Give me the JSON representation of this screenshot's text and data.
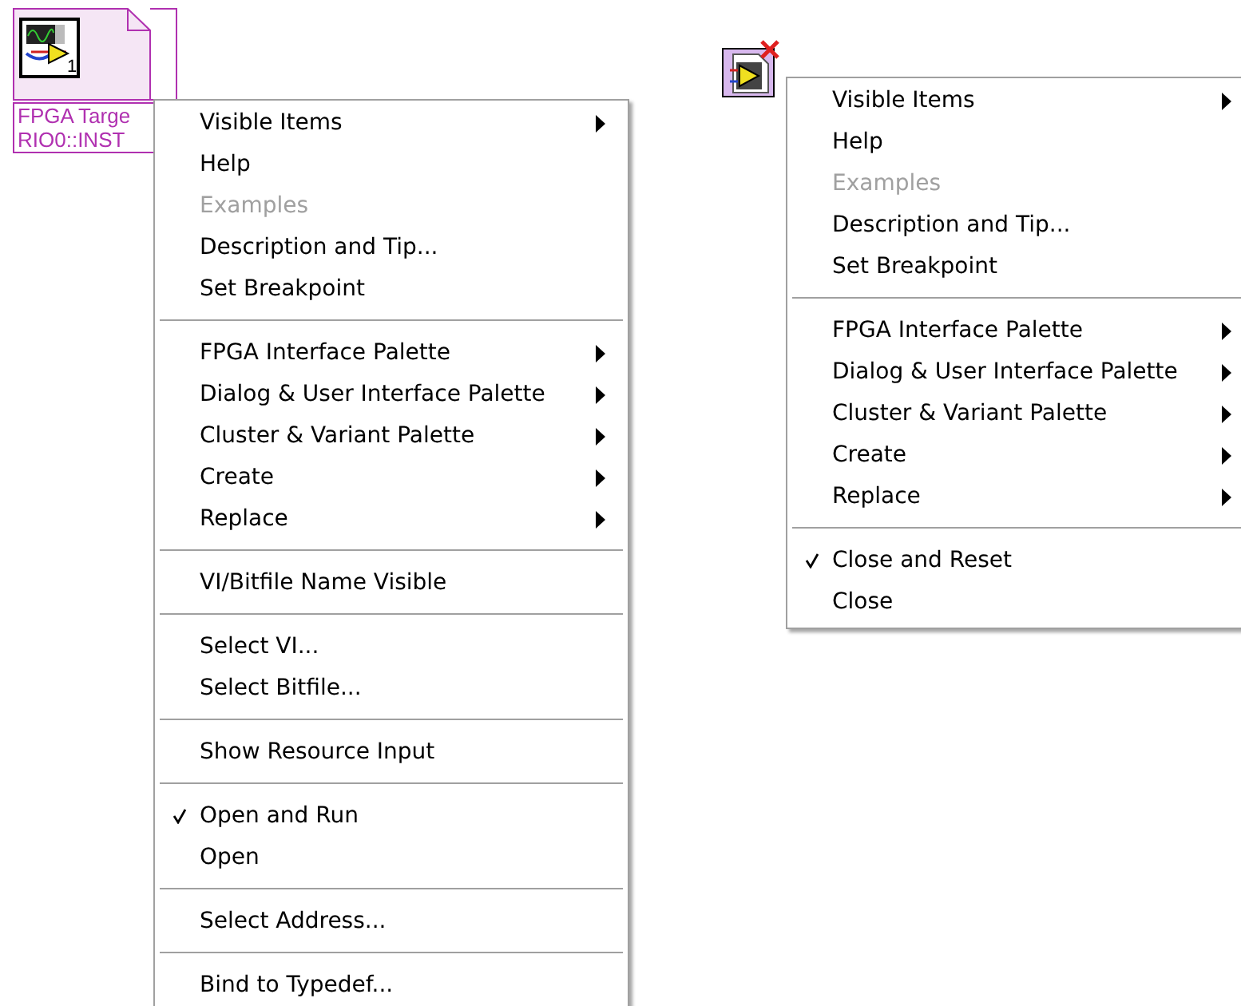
{
  "nodes": [
    {
      "kind": "target",
      "badge": "1",
      "label_lines": [
        "FPGA Targe",
        "RIO0::INST"
      ]
    },
    {
      "kind": "close"
    }
  ],
  "menus": [
    {
      "groups": [
        [
          {
            "label": "Visible Items",
            "submenu": true,
            "disabled": false,
            "checked": false
          },
          {
            "label": "Help",
            "submenu": false,
            "disabled": false,
            "checked": false
          },
          {
            "label": "Examples",
            "submenu": false,
            "disabled": true,
            "checked": false
          },
          {
            "label": "Description and Tip...",
            "submenu": false,
            "disabled": false,
            "checked": false
          },
          {
            "label": "Set Breakpoint",
            "submenu": false,
            "disabled": false,
            "checked": false
          }
        ],
        [
          {
            "label": "FPGA Interface Palette",
            "submenu": true,
            "disabled": false,
            "checked": false
          },
          {
            "label": "Dialog & User Interface Palette",
            "submenu": true,
            "disabled": false,
            "checked": false
          },
          {
            "label": "Cluster & Variant Palette",
            "submenu": true,
            "disabled": false,
            "checked": false
          },
          {
            "label": "Create",
            "submenu": true,
            "disabled": false,
            "checked": false
          },
          {
            "label": "Replace",
            "submenu": true,
            "disabled": false,
            "checked": false
          }
        ],
        [
          {
            "label": "VI/Bitfile Name Visible",
            "submenu": false,
            "disabled": false,
            "checked": false
          }
        ],
        [
          {
            "label": "Select VI...",
            "submenu": false,
            "disabled": false,
            "checked": false
          },
          {
            "label": "Select Bitfile...",
            "submenu": false,
            "disabled": false,
            "checked": false
          }
        ],
        [
          {
            "label": "Show Resource Input",
            "submenu": false,
            "disabled": false,
            "checked": false
          }
        ],
        [
          {
            "label": "Open and Run",
            "submenu": false,
            "disabled": false,
            "checked": true
          },
          {
            "label": "Open",
            "submenu": false,
            "disabled": false,
            "checked": false
          }
        ],
        [
          {
            "label": "Select Address...",
            "submenu": false,
            "disabled": false,
            "checked": false
          }
        ],
        [
          {
            "label": "Bind to Typedef...",
            "submenu": false,
            "disabled": false,
            "checked": false
          }
        ]
      ]
    },
    {
      "groups": [
        [
          {
            "label": "Visible Items",
            "submenu": true,
            "disabled": false,
            "checked": false
          },
          {
            "label": "Help",
            "submenu": false,
            "disabled": false,
            "checked": false
          },
          {
            "label": "Examples",
            "submenu": false,
            "disabled": true,
            "checked": false
          },
          {
            "label": "Description and Tip...",
            "submenu": false,
            "disabled": false,
            "checked": false
          },
          {
            "label": "Set Breakpoint",
            "submenu": false,
            "disabled": false,
            "checked": false
          }
        ],
        [
          {
            "label": "FPGA Interface Palette",
            "submenu": true,
            "disabled": false,
            "checked": false
          },
          {
            "label": "Dialog & User Interface Palette",
            "submenu": true,
            "disabled": false,
            "checked": false
          },
          {
            "label": "Cluster & Variant Palette",
            "submenu": true,
            "disabled": false,
            "checked": false
          },
          {
            "label": "Create",
            "submenu": true,
            "disabled": false,
            "checked": false
          },
          {
            "label": "Replace",
            "submenu": true,
            "disabled": false,
            "checked": false
          }
        ],
        [
          {
            "label": "Close and Reset",
            "submenu": false,
            "disabled": false,
            "checked": true
          },
          {
            "label": "Close",
            "submenu": false,
            "disabled": false,
            "checked": false
          }
        ]
      ]
    }
  ]
}
